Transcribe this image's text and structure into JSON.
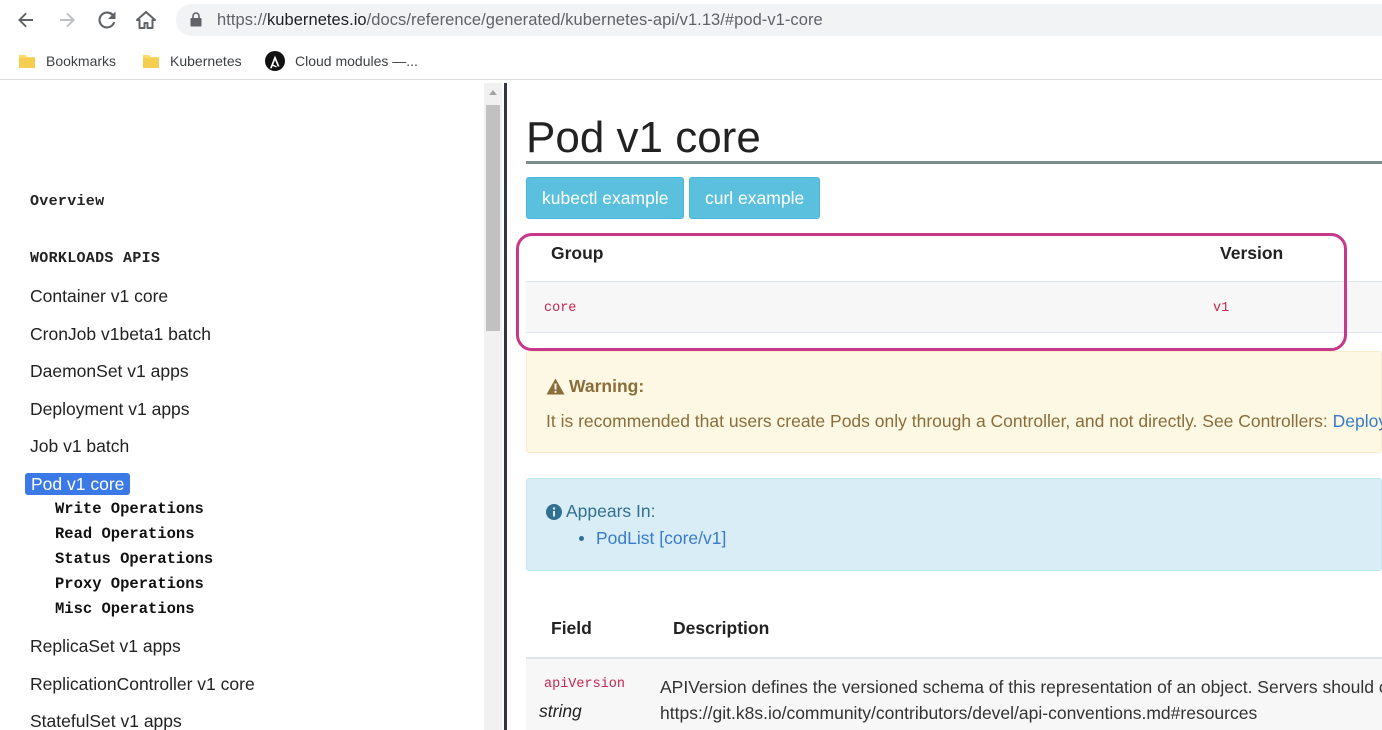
{
  "browser": {
    "url_prefix": "https://",
    "url_host": "kubernetes.io",
    "url_path": "/docs/reference/generated/kubernetes-api/v1.13/#pod-v1-core"
  },
  "bookmarks": [
    {
      "label": "Bookmarks",
      "icon": "folder-icon"
    },
    {
      "label": "Kubernetes",
      "icon": "folder-icon"
    },
    {
      "label": "Cloud modules —...",
      "icon": "ansible-logo-icon"
    }
  ],
  "sidebar": {
    "overview": "Overview",
    "section_title": "WORKLOADS APIS",
    "items": [
      "Container v1 core",
      "CronJob v1beta1 batch",
      "DaemonSet v1 apps",
      "Deployment v1 apps",
      "Job v1 batch"
    ],
    "active_item": "Pod v1 core",
    "sub_items": [
      "Write Operations",
      "Read Operations",
      "Status Operations",
      "Proxy Operations",
      "Misc Operations"
    ],
    "items_after": [
      "ReplicaSet v1 apps",
      "ReplicationController v1 core",
      "StatefulSet v1 apps"
    ]
  },
  "main": {
    "title": "Pod v1 core",
    "buttons": {
      "kubectl": "kubectl example",
      "curl": "curl example"
    },
    "group_table": {
      "headers": {
        "group": "Group",
        "version": "Version"
      },
      "row": {
        "group": "core",
        "version": "v1"
      }
    },
    "warning": {
      "title": "Warning:",
      "text": "It is recommended that users create Pods only through a Controller, and not directly. See Controllers: ",
      "link": "Deploy"
    },
    "appears_in": {
      "title": "Appears In:",
      "items": [
        "PodList [core/v1]"
      ]
    },
    "fields_table": {
      "headers": {
        "field": "Field",
        "description": "Description"
      },
      "rows": [
        {
          "field": "apiVersion",
          "type": "string",
          "description_line1": "APIVersion defines the versioned schema of this representation of an object. Servers should c",
          "description_line2": "https://git.k8s.io/community/contributors/devel/api-conventions.md#resources"
        }
      ]
    }
  },
  "colors": {
    "accent_button": "#5bc0de",
    "active_nav": "#3b79e6",
    "highlight_border": "#c7378a",
    "code_text": "#c7254e",
    "warning_bg": "#fcf8e3",
    "info_bg": "#d9edf7"
  }
}
